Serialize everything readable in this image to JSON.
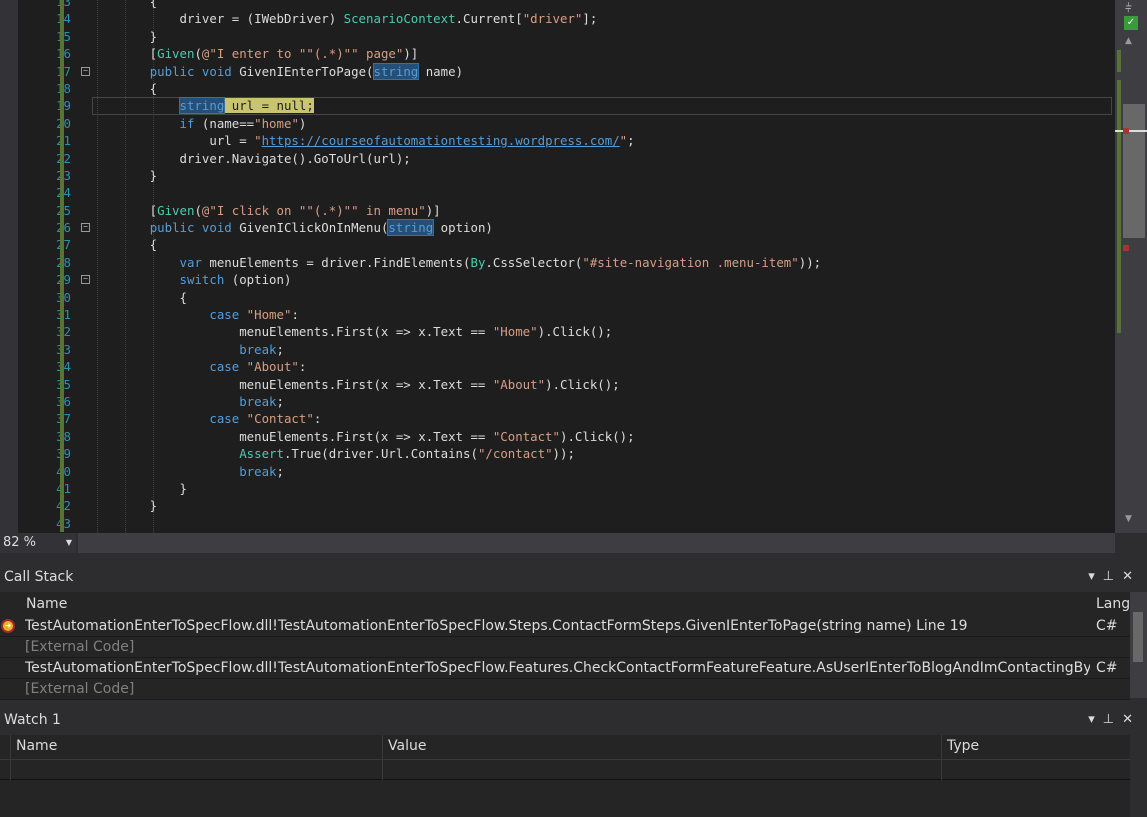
{
  "editor": {
    "lines": [
      {
        "n": "13",
        "t": [
          [
            "        {",
            ""
          ]
        ]
      },
      {
        "n": "14",
        "t": [
          [
            "            driver = (IWebDriver) ",
            ""
          ],
          [
            "ScenarioContext",
            "ty"
          ],
          [
            ".Current[",
            ""
          ],
          [
            "\"driver\"",
            "st"
          ],
          [
            "];",
            ""
          ]
        ]
      },
      {
        "n": "15",
        "t": [
          [
            "        }",
            ""
          ]
        ]
      },
      {
        "n": "16",
        "t": [
          [
            "        [",
            ""
          ],
          [
            "Given",
            "ty"
          ],
          [
            "(",
            ""
          ],
          [
            "@\"I enter to \"\"(.*)\"\" page\"",
            "st"
          ],
          [
            ")]",
            ""
          ]
        ]
      },
      {
        "n": "17",
        "fold": true,
        "t": [
          [
            "        ",
            ""
          ],
          [
            "public void ",
            "kw"
          ],
          [
            "GivenIEnterToPage(",
            ""
          ],
          [
            "string",
            "kw hlt"
          ],
          [
            " name)",
            ""
          ]
        ]
      },
      {
        "n": "18",
        "t": [
          [
            "        {",
            ""
          ]
        ]
      },
      {
        "n": "19",
        "current": true,
        "t": [
          [
            "            ",
            ""
          ],
          [
            "string",
            "kw hlt"
          ],
          [
            " url = null;",
            "cur"
          ]
        ]
      },
      {
        "n": "20",
        "t": [
          [
            "            ",
            ""
          ],
          [
            "if",
            "kw"
          ],
          [
            " (name==",
            ""
          ],
          [
            "\"home\"",
            "st"
          ],
          [
            ")",
            ""
          ]
        ]
      },
      {
        "n": "21",
        "t": [
          [
            "                url = ",
            ""
          ],
          [
            "\"",
            "st"
          ],
          [
            "https://courseofautomationtesting.wordpress.com/",
            "ln2"
          ],
          [
            "\"",
            "st"
          ],
          [
            ";",
            ""
          ]
        ]
      },
      {
        "n": "22",
        "t": [
          [
            "            driver.Navigate().GoToUrl(url);",
            ""
          ]
        ]
      },
      {
        "n": "23",
        "t": [
          [
            "        }",
            ""
          ]
        ]
      },
      {
        "n": "24",
        "t": [
          [
            "",
            ""
          ]
        ]
      },
      {
        "n": "25",
        "t": [
          [
            "        [",
            ""
          ],
          [
            "Given",
            "ty"
          ],
          [
            "(",
            ""
          ],
          [
            "@\"I click on \"\"(.*)\"\" in menu\"",
            "st"
          ],
          [
            ")]",
            ""
          ]
        ]
      },
      {
        "n": "26",
        "fold": true,
        "t": [
          [
            "        ",
            ""
          ],
          [
            "public void ",
            "kw"
          ],
          [
            "GivenIClickOnInMenu(",
            ""
          ],
          [
            "string",
            "kw hlt"
          ],
          [
            " option)",
            ""
          ]
        ]
      },
      {
        "n": "27",
        "t": [
          [
            "        {",
            ""
          ]
        ]
      },
      {
        "n": "28",
        "t": [
          [
            "            ",
            ""
          ],
          [
            "var",
            "kw"
          ],
          [
            " menuElements = driver.FindElements(",
            ""
          ],
          [
            "By",
            "ty"
          ],
          [
            ".CssSelector(",
            ""
          ],
          [
            "\"#site-navigation .menu-item\"",
            "st"
          ],
          [
            "));",
            ""
          ]
        ]
      },
      {
        "n": "29",
        "fold": true,
        "t": [
          [
            "            ",
            ""
          ],
          [
            "switch",
            "kw"
          ],
          [
            " (option)",
            ""
          ]
        ]
      },
      {
        "n": "30",
        "t": [
          [
            "            {",
            ""
          ]
        ]
      },
      {
        "n": "31",
        "t": [
          [
            "                ",
            ""
          ],
          [
            "case ",
            "kw"
          ],
          [
            "\"Home\"",
            "st"
          ],
          [
            ":",
            ""
          ]
        ]
      },
      {
        "n": "32",
        "t": [
          [
            "                    menuElements.First(x => x.Text == ",
            ""
          ],
          [
            "\"Home\"",
            "st"
          ],
          [
            ").Click();",
            ""
          ]
        ]
      },
      {
        "n": "33",
        "t": [
          [
            "                    ",
            ""
          ],
          [
            "break",
            "kw"
          ],
          [
            ";",
            ""
          ]
        ]
      },
      {
        "n": "34",
        "t": [
          [
            "                ",
            ""
          ],
          [
            "case ",
            "kw"
          ],
          [
            "\"About\"",
            "st"
          ],
          [
            ":",
            ""
          ]
        ]
      },
      {
        "n": "35",
        "t": [
          [
            "                    menuElements.First(x => x.Text == ",
            ""
          ],
          [
            "\"About\"",
            "st"
          ],
          [
            ").Click();",
            ""
          ]
        ]
      },
      {
        "n": "36",
        "t": [
          [
            "                    ",
            ""
          ],
          [
            "break",
            "kw"
          ],
          [
            ";",
            ""
          ]
        ]
      },
      {
        "n": "37",
        "t": [
          [
            "                ",
            ""
          ],
          [
            "case ",
            "kw"
          ],
          [
            "\"Contact\"",
            "st"
          ],
          [
            ":",
            ""
          ]
        ]
      },
      {
        "n": "38",
        "t": [
          [
            "                    menuElements.First(x => x.Text == ",
            ""
          ],
          [
            "\"Contact\"",
            "st"
          ],
          [
            ").Click();",
            ""
          ]
        ]
      },
      {
        "n": "39",
        "t": [
          [
            "                    ",
            ""
          ],
          [
            "Assert",
            "ty"
          ],
          [
            ".True(driver.Url.Contains(",
            ""
          ],
          [
            "\"/contact\"",
            "st"
          ],
          [
            "));",
            ""
          ]
        ]
      },
      {
        "n": "40",
        "t": [
          [
            "                    ",
            ""
          ],
          [
            "break",
            "kw"
          ],
          [
            ";",
            ""
          ]
        ]
      },
      {
        "n": "41",
        "t": [
          [
            "            }",
            ""
          ]
        ]
      },
      {
        "n": "42",
        "t": [
          [
            "        }",
            ""
          ]
        ]
      },
      {
        "n": "43",
        "t": [
          [
            "",
            ""
          ]
        ]
      }
    ],
    "zoom": "82 %"
  },
  "call_stack": {
    "title": "Call Stack",
    "col_name": "Name",
    "col_lang": "Lang",
    "rows": [
      {
        "name": "TestAutomationEnterToSpecFlow.dll!TestAutomationEnterToSpecFlow.Steps.ContactFormSteps.GivenIEnterToPage(string name) Line 19",
        "lang": "C#",
        "current": true
      },
      {
        "name": "[External Code]",
        "lang": "",
        "ext": true
      },
      {
        "name": "TestAutomationEnterToSpecFlow.dll!TestAutomationEnterToSpecFlow.Features.CheckContactFormFeatureFeature.AsUserIEnterToBlogAndImContactingByContactF",
        "lang": "C#"
      },
      {
        "name": "[External Code]",
        "lang": "",
        "ext": true
      }
    ]
  },
  "watch": {
    "title": "Watch 1",
    "col_name": "Name",
    "col_value": "Value",
    "col_type": "Type"
  },
  "colors": {
    "keyword": "#569cd6",
    "string": "#d69d85",
    "type": "#4ec9b0",
    "line_number": "#2b91af",
    "current_line": "#c9c470",
    "breakpoint": "#e8b32c"
  }
}
